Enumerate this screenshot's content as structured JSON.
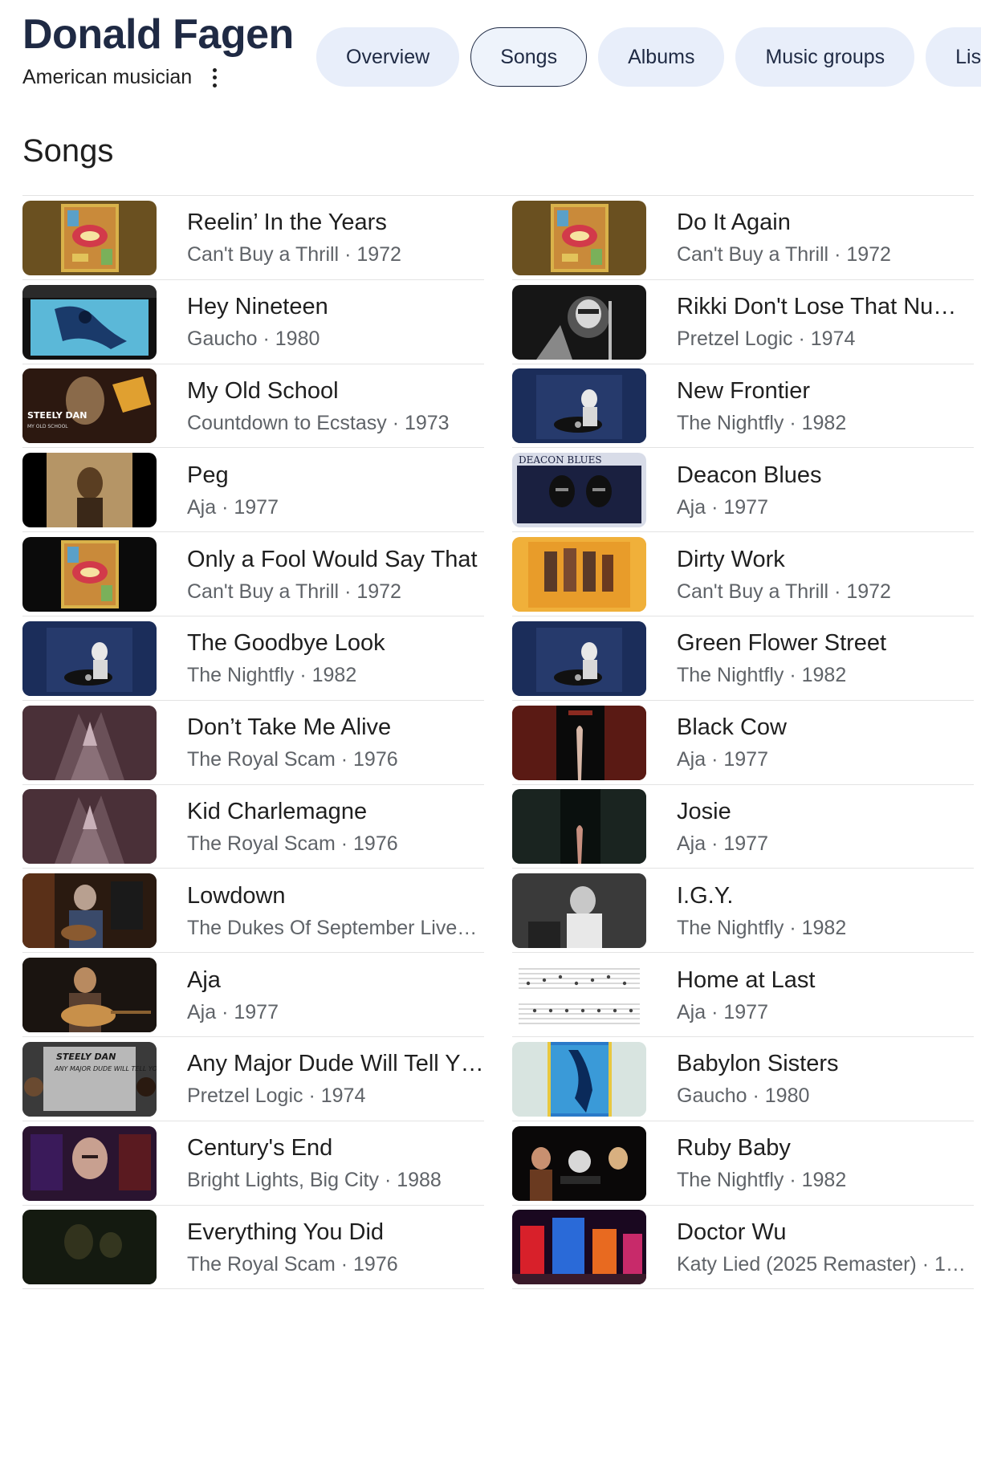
{
  "header": {
    "artist_name": "Donald Fagen",
    "artist_description": "American musician",
    "more_icon": "vertical-dots-icon"
  },
  "tabs": [
    {
      "label": "Overview",
      "active": false
    },
    {
      "label": "Songs",
      "active": true
    },
    {
      "label": "Albums",
      "active": false
    },
    {
      "label": "Music groups",
      "active": false
    },
    {
      "label": "Lis",
      "active": false
    }
  ],
  "section_title": "Songs",
  "songs": [
    {
      "title": "Reelin’ In the Years",
      "album": "Can't Buy a Thrill",
      "year": "1972",
      "art": "thrill"
    },
    {
      "title": "Do It Again",
      "album": "Can't Buy a Thrill",
      "year": "1972",
      "art": "thrill"
    },
    {
      "title": "Hey Nineteen",
      "album": "Gaucho",
      "year": "1980",
      "art": "gaucho-video"
    },
    {
      "title": "Rikki Don't Lose That Nu…",
      "album": "Pretzel Logic",
      "year": "1974",
      "art": "bw-live"
    },
    {
      "title": "My Old School",
      "album": "Countdown to Ecstasy",
      "year": "1973",
      "art": "steely-oldschool"
    },
    {
      "title": "New Frontier",
      "album": "The Nightfly",
      "year": "1982",
      "art": "nightfly"
    },
    {
      "title": "Peg",
      "album": "Aja",
      "year": "1977",
      "art": "sepia-photo"
    },
    {
      "title": "Deacon Blues",
      "album": "Aja",
      "year": "1977",
      "art": "deacon"
    },
    {
      "title": "Only a Fool Would Say That",
      "album": "Can't Buy a Thrill",
      "year": "1972",
      "art": "thrill-black"
    },
    {
      "title": "Dirty Work",
      "album": "Can't Buy a Thrill",
      "year": "1972",
      "art": "yellow-band"
    },
    {
      "title": "The Goodbye Look",
      "album": "The Nightfly",
      "year": "1982",
      "art": "nightfly"
    },
    {
      "title": "Green Flower Street",
      "album": "The Nightfly",
      "year": "1982",
      "art": "nightfly"
    },
    {
      "title": "Don’t Take Me Alive",
      "album": "The Royal Scam",
      "year": "1976",
      "art": "royal-scam"
    },
    {
      "title": "Black Cow",
      "album": "Aja",
      "year": "1977",
      "art": "aja-red"
    },
    {
      "title": "Kid Charlemagne",
      "album": "The Royal Scam",
      "year": "1976",
      "art": "royal-scam"
    },
    {
      "title": "Josie",
      "album": "Aja",
      "year": "1977",
      "art": "aja-dark"
    },
    {
      "title": "Lowdown",
      "album": "The Dukes Of September Live…",
      "year": "",
      "art": "live-guitar"
    },
    {
      "title": "I.G.Y.",
      "album": "The Nightfly",
      "year": "1982",
      "art": "bw-nightfly"
    },
    {
      "title": "Aja",
      "album": "Aja",
      "year": "1977",
      "art": "guitar-player"
    },
    {
      "title": "Home at Last",
      "album": "Aja",
      "year": "1977",
      "art": "sheet-music"
    },
    {
      "title": "Any Major Dude Will Tell Y…",
      "album": "Pretzel Logic",
      "year": "1974",
      "art": "steely-dude"
    },
    {
      "title": "Babylon Sisters",
      "album": "Gaucho",
      "year": "1980",
      "art": "gaucho"
    },
    {
      "title": "Century's End",
      "album": "Bright Lights, Big City",
      "year": "1988",
      "art": "centurys-end"
    },
    {
      "title": "Ruby Baby",
      "album": "The Nightfly",
      "year": "1982",
      "art": "concert"
    },
    {
      "title": "Everything You Did",
      "album": "The Royal Scam",
      "year": "1976",
      "art": "dark-green"
    },
    {
      "title": "Doctor Wu",
      "album": "Katy Lied (2025 Remaster)",
      "year": "1…",
      "art": "neon-city"
    }
  ],
  "artwork_texts": {
    "steely_dan": "STEELY DAN",
    "my_old_school": "MY OLD SCHOOL",
    "deacon_blues": "DEACON BLUES",
    "any_major_dude": "ANY MAJOR DUDE WILL TELL YOU"
  },
  "colors": {
    "tab_bg": "#e8eefa",
    "tab_text": "#1f2a44",
    "title_text": "#1f2a44",
    "secondary_text": "#5f6368",
    "divider": "#e3e3e3"
  }
}
